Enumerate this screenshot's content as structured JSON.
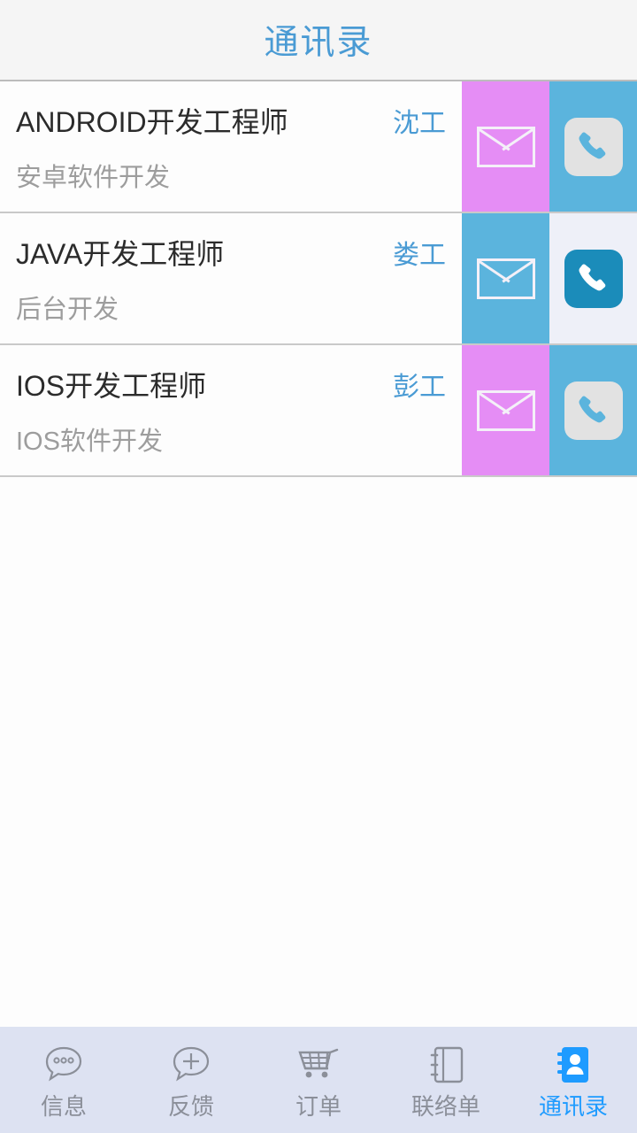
{
  "header": {
    "title": "通讯录",
    "title_color": "#4a9bd4",
    "background": "#f5f5f5"
  },
  "contacts": [
    {
      "title": "ANDROID开发工程师",
      "person": "沈工",
      "subtitle": "安卓软件开发",
      "message_button": {
        "icon": "envelope-icon",
        "background": "#e58df5"
      },
      "call_button": {
        "icon": "phone-icon",
        "background": "#5bb4dd",
        "tile": "#e2e2e2"
      }
    },
    {
      "title": "JAVA开发工程师",
      "person": "娄工",
      "subtitle": "后台开发",
      "message_button": {
        "icon": "envelope-icon",
        "background": "#5bb4dd"
      },
      "call_button": {
        "icon": "phone-icon",
        "background": "#eef0f8",
        "tile": "#1b8cba"
      }
    },
    {
      "title": "IOS开发工程师",
      "person": "彭工",
      "subtitle": "IOS软件开发",
      "message_button": {
        "icon": "envelope-icon",
        "background": "#e58df5"
      },
      "call_button": {
        "icon": "phone-icon",
        "background": "#5bb4dd",
        "tile": "#e2e2e2"
      }
    }
  ],
  "tabbar": {
    "background": "#dde2f2",
    "active_color": "#1e9bff",
    "inactive_color": "#8b8f99",
    "items": [
      {
        "label": "信息",
        "icon": "chat-dots-icon",
        "active": false
      },
      {
        "label": "反馈",
        "icon": "chat-plus-icon",
        "active": false
      },
      {
        "label": "订单",
        "icon": "shopping-cart-icon",
        "active": false
      },
      {
        "label": "联络单",
        "icon": "notebook-icon",
        "active": false
      },
      {
        "label": "通讯录",
        "icon": "contact-book-icon",
        "active": true
      }
    ]
  }
}
